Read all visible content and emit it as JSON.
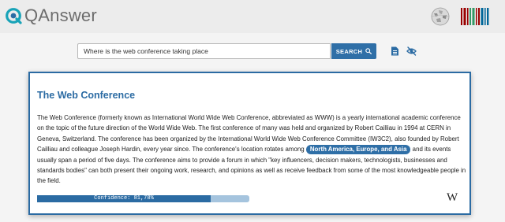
{
  "header": {
    "app_name": "QAnswer",
    "icons": [
      "qanswer-logo-icon",
      "wikipedia-globe-icon",
      "wikidata-barcode-icon"
    ]
  },
  "search": {
    "value": "Where is the web conference taking place",
    "button_label": "SEARCH",
    "icons": [
      "document-icon",
      "eye-slash-icon"
    ]
  },
  "answer": {
    "title": "The Web Conference",
    "text_before": "The Web Conference (formerly known as International World Wide Web Conference, abbreviated as WWW) is a yearly international academic conference on the topic of the future direction of the World Wide Web. The first conference of many was held and organized by Robert Cailliau in 1994 at CERN in Geneva, Switzerland. The conference has been organized by the International World Wide Web Conference Committee (IW3C2), also founded by Robert Cailliau and colleague Joseph Hardin, every year since. The conference's location rotates among ",
    "highlight": "North America, Europe, and Asia",
    "text_after": " and its events usually span a period of five days. The conference aims to provide a forum in which \"key influencers, decision makers, technologists, businesses and standards bodies\" can both present their ongoing work, research, and opinions as well as receive feedback from some of the most knowledgeable people in the field.",
    "confidence_label": "Confidence: 81,78%",
    "confidence_fraction": 0.8178,
    "source_icon": "wikipedia-w-icon",
    "source_glyph": "W"
  },
  "colors": {
    "accent": "#2b6ba3",
    "button": "#2f6fa7",
    "bar_track": "#a5c4de",
    "logo_teal": "#18a3b8"
  }
}
